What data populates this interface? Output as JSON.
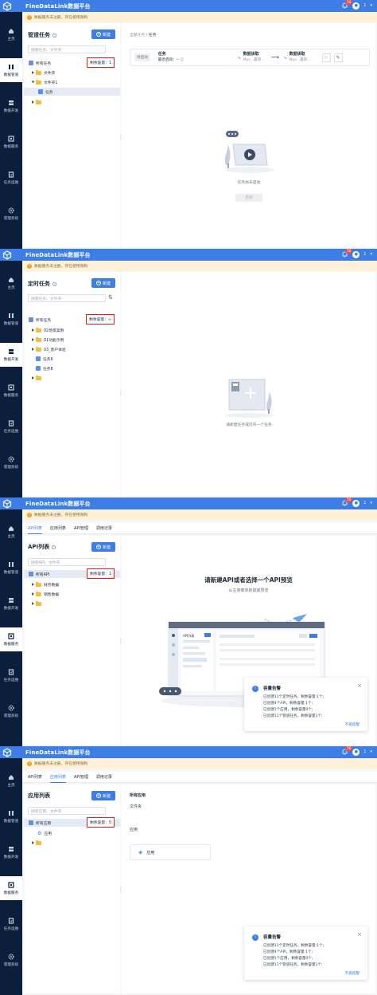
{
  "app": {
    "title": "FineDataLink数据平台",
    "notification_count": "56",
    "user": "1"
  },
  "notice": "数据服务未注册，存在使用限制",
  "nav": [
    {
      "id": "home",
      "label": "主页",
      "icon": "home-icon"
    },
    {
      "id": "pipeline",
      "label": "数据管道",
      "icon": "pipeline-icon"
    },
    {
      "id": "dev",
      "label": "数据开发",
      "icon": "dev-icon"
    },
    {
      "id": "service",
      "label": "数据服务",
      "icon": "service-icon"
    },
    {
      "id": "ops",
      "label": "任务运维",
      "icon": "ops-icon"
    },
    {
      "id": "admin",
      "label": "管理系统",
      "icon": "gear-icon"
    }
  ],
  "p1": {
    "tree_title": "管道任务",
    "new_label": "新建",
    "search_placeholder": "搜索任务、文件夹",
    "root": "所有任务",
    "capacity": "剩余容量：1",
    "items": [
      "文件夹",
      "文件夹1",
      "任务"
    ],
    "breadcrumb_root": "全部任务",
    "breadcrumb_sep": "/",
    "breadcrumb_current": "任务",
    "status": "待启动",
    "task_name": "任务",
    "last_start": "最近启动：--",
    "source_title": "数据读取",
    "source_sub": "Mys...最新...",
    "target_title": "数据读取",
    "target_sub": "Mys...最新...",
    "empty_msg": "任务尚未启动",
    "empty_btn": "启动"
  },
  "p2": {
    "tree_title": "定时任务",
    "new_label": "新建",
    "search_placeholder": "搜索任务、文件夹",
    "root": "所有任务",
    "capacity": "剩余容量：∞",
    "items": [
      "02场景案例",
      "01功能示例",
      "03_客户体验",
      "任务6",
      "任务8"
    ],
    "empty_msg": "请新建任务或打开一个任务"
  },
  "p3": {
    "tabs": [
      "API列表",
      "应用列表",
      "API管理",
      "调用记录"
    ],
    "tree_title": "API列表",
    "new_label": "新建",
    "search_placeholder": "搜索API、文件夹",
    "root": "所有API",
    "capacity": "剩余容量：1",
    "items": [
      "财务数据",
      "销售数据"
    ],
    "empty_title": "请新建API或者选择一个API预览",
    "empty_sub": "从左侧菜单新建或预览",
    "mock_title": "API列表"
  },
  "p4": {
    "tabs": [
      "API列表",
      "应用列表",
      "API管理",
      "调用记录"
    ],
    "tree_title": "应用列表",
    "new_label": "新建",
    "search_placeholder": "搜索应用、文件夹",
    "root": "所有应用",
    "capacity": "剩余容量：0",
    "items": [
      "应用"
    ],
    "all_apps": "所有应用",
    "folder_label": "文件夹",
    "app_section": "应用",
    "app_card": "应用"
  },
  "alert": {
    "title": "容量告警",
    "lines": [
      "已创建11个定时任务，剩余容量:1个;",
      "已创建4个API，剩余容量:1个;",
      "已创建1个应用，剩余容量0个;",
      "已创建11个管道任务，剩余容量1个;"
    ],
    "footer": "不再提醒"
  }
}
